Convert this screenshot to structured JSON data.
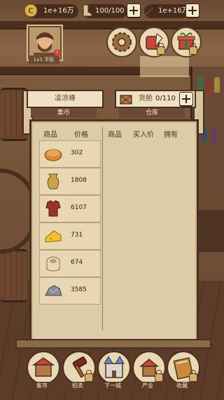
{
  "resources": {
    "coins": {
      "icon": "coin-icon",
      "value": "1e+16万"
    },
    "stamina": {
      "icon": "boot-icon",
      "value": "100/100"
    },
    "gems": {
      "icon": "sword-icon",
      "value": "1e+16万"
    }
  },
  "player": {
    "level_label": "Lv1 平民",
    "badge": "!"
  },
  "top_buttons": [
    {
      "name": "gear-button",
      "icon": "cog-icon",
      "locked": false
    },
    {
      "name": "skills-button",
      "icon": "quill-scroll-icon",
      "locked": true
    },
    {
      "name": "gift-button",
      "icon": "gift-icon",
      "locked": true
    }
  ],
  "market": {
    "location": "凌凉峰",
    "tab_market": "集市",
    "cargo_label": "货舱",
    "cargo_value": "0/110",
    "tab_warehouse": "仓库"
  },
  "sell_headers": {
    "item": "商品",
    "price": "价格"
  },
  "buy_headers": {
    "item": "商品",
    "buy_price": "买入价",
    "owned": "拥有"
  },
  "goods": [
    {
      "icon": "bread-icon",
      "price": "302"
    },
    {
      "icon": "urn-icon",
      "price": "1808"
    },
    {
      "icon": "armor-icon",
      "price": "6107"
    },
    {
      "icon": "cheese-icon",
      "price": "731"
    },
    {
      "icon": "cloth-bundle-icon",
      "price": "674"
    },
    {
      "icon": "ore-icon",
      "price": "3585"
    }
  ],
  "nav": [
    {
      "label": "集市",
      "icon": "market-stall-icon"
    },
    {
      "label": "拍卖",
      "icon": "gavel-icon"
    },
    {
      "label": "下一城",
      "icon": "castle-icon"
    },
    {
      "label": "产业",
      "icon": "property-icon"
    },
    {
      "label": "收藏",
      "icon": "book-icon"
    }
  ]
}
